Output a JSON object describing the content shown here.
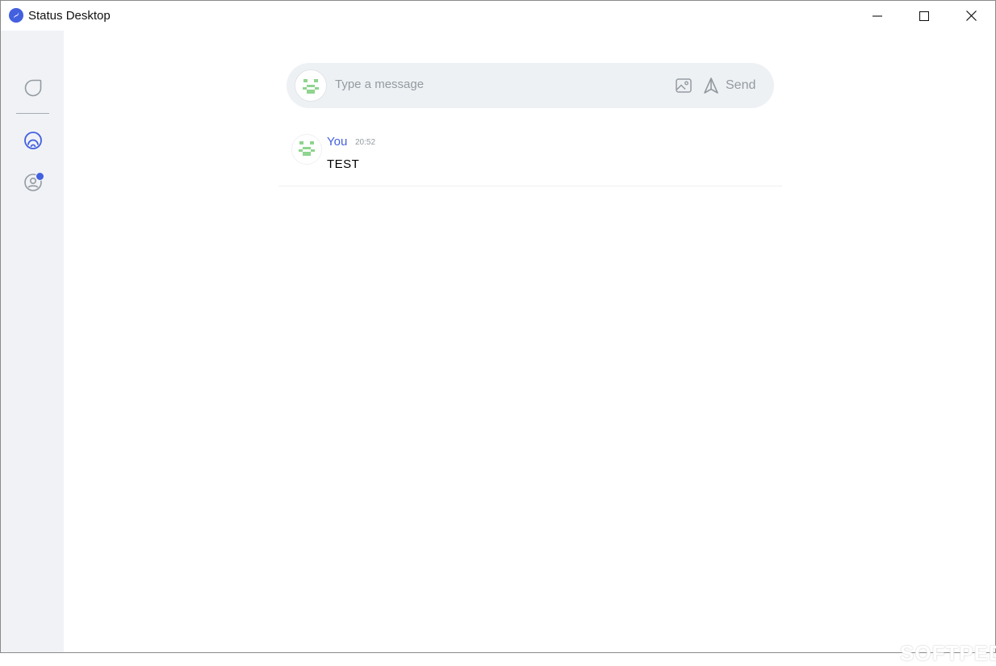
{
  "window": {
    "title": "Status Desktop",
    "controls": [
      "minimize-icon",
      "maximize-icon",
      "close-icon"
    ]
  },
  "sidebar": {
    "items": [
      {
        "name": "chat",
        "icon": "chat-bubble-icon",
        "active": false
      },
      {
        "name": "browser",
        "icon": "dapp-browser-icon",
        "active": true
      },
      {
        "name": "profile",
        "icon": "profile-icon",
        "active": false,
        "badge": true
      }
    ]
  },
  "composer": {
    "placeholder": "Type a message",
    "image_icon": "image-icon",
    "send_label": "Send",
    "send_icon": "send-arrow-icon"
  },
  "messages": [
    {
      "author": "You",
      "time": "20:52",
      "text": "TEST"
    }
  ],
  "watermark": "SOFTPEDIA",
  "colors": {
    "accent": "#4360df",
    "sidebar_bg": "#f0f2f6",
    "composer_bg": "#eef1f4",
    "muted_text": "#939ba1",
    "avatar_green": "#8fd48f"
  }
}
